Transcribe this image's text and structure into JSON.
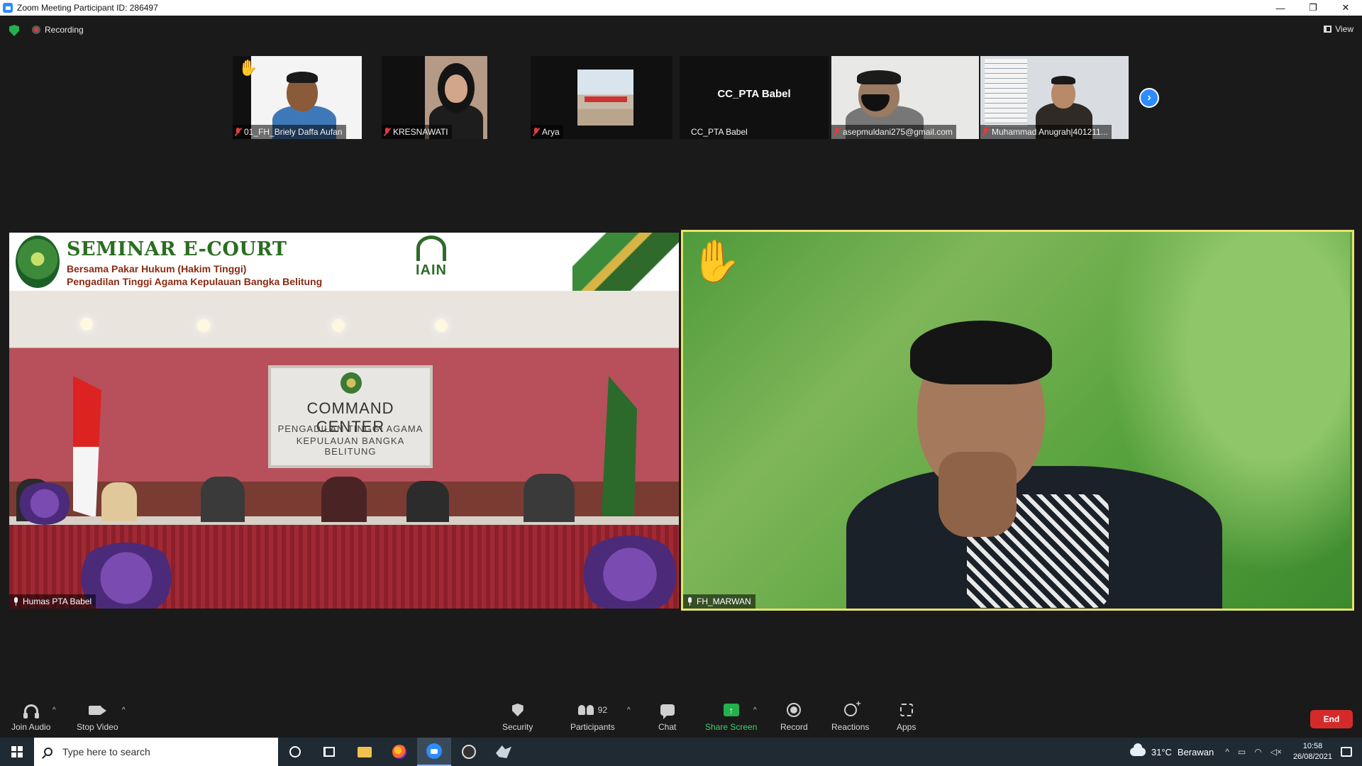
{
  "window": {
    "title": "Zoom Meeting Participant ID: 286497",
    "controls": [
      "—",
      "❐",
      "✕"
    ]
  },
  "meeting": {
    "recording_label": "Recording",
    "view_label": "View"
  },
  "thumbnails": [
    {
      "name": "01_FH_Briely Daffa Aufan",
      "muted": true,
      "hand_raised": true
    },
    {
      "name": "KRESNAWATI",
      "muted": true,
      "hand_raised": false
    },
    {
      "name": "Arya",
      "muted": true,
      "hand_raised": false
    },
    {
      "name": "CC_PTA Babel",
      "muted": false,
      "hand_raised": false,
      "center_text": "CC_PTA Babel"
    },
    {
      "name": "asepmuldani275@gmail.com",
      "muted": true,
      "hand_raised": false
    },
    {
      "name": "Muhammad Anugrah|401211...",
      "muted": true,
      "hand_raised": false
    }
  ],
  "main_left": {
    "participant": "Humas PTA Babel",
    "slide": {
      "title": "SEMINAR E-COURT",
      "subtitle1": "Bersama Pakar Hukum (Hakim Tinggi)",
      "subtitle2": "Pengadilan Tinggi Agama Kepulauan Bangka Belitung",
      "logo_text": "IAIN"
    },
    "board": {
      "title": "COMMAND CENTER",
      "line2": "PENGADILAN TINGGI AGAMA",
      "line3": "KEPULAUAN BANGKA BELITUNG"
    }
  },
  "main_right": {
    "participant": "FH_MARWAN",
    "hand_raised": true
  },
  "controls": {
    "join_audio": "Join Audio",
    "stop_video": "Stop Video",
    "security": "Security",
    "participants": "Participants",
    "participants_count": "92",
    "chat": "Chat",
    "share_screen": "Share Screen",
    "record": "Record",
    "reactions": "Reactions",
    "apps": "Apps",
    "end": "End"
  },
  "taskbar": {
    "search_placeholder": "Type here to search",
    "weather_temp": "31°C",
    "weather_desc": "Berawan",
    "time": "10:58",
    "date": "26/08/2021"
  },
  "colors": {
    "accent_blue": "#2d8cff",
    "active_speaker_border": "#e6e36c",
    "end_red": "#d52a2a",
    "share_green": "#23b14d"
  }
}
